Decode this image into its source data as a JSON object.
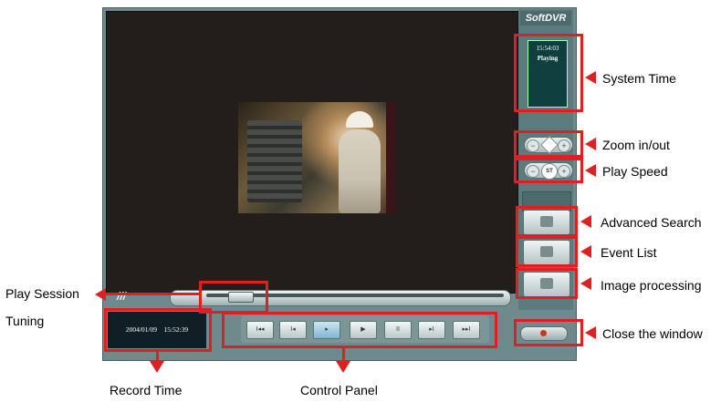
{
  "window": {
    "brand": "SoftDVR",
    "clock": {
      "time": "15:54:03",
      "status": "Playing"
    },
    "record_time": {
      "date": "2004/01/09",
      "time": "15:52:39"
    },
    "speed_label": "ST",
    "controls": [
      {
        "name": "skip-to-start",
        "glyph": "I◂◂"
      },
      {
        "name": "step-back",
        "glyph": "I◂"
      },
      {
        "name": "slow-play",
        "glyph": "▸"
      },
      {
        "name": "play",
        "glyph": "▶"
      },
      {
        "name": "pause",
        "glyph": "II"
      },
      {
        "name": "step-forward",
        "glyph": "▸I"
      },
      {
        "name": "skip-to-end",
        "glyph": "▸▸I"
      }
    ]
  },
  "annotations": {
    "system_time": "System Time",
    "zoom": "Zoom in/out",
    "play_speed": "Play Speed",
    "advanced_search": "Advanced Search",
    "event_list": "Event List",
    "image_processing": "Image processing",
    "close_window": "Close the window",
    "play_session_1": "Play Session",
    "play_session_2": "Tuning",
    "record_time": "Record Time",
    "control_panel": "Control Panel"
  }
}
